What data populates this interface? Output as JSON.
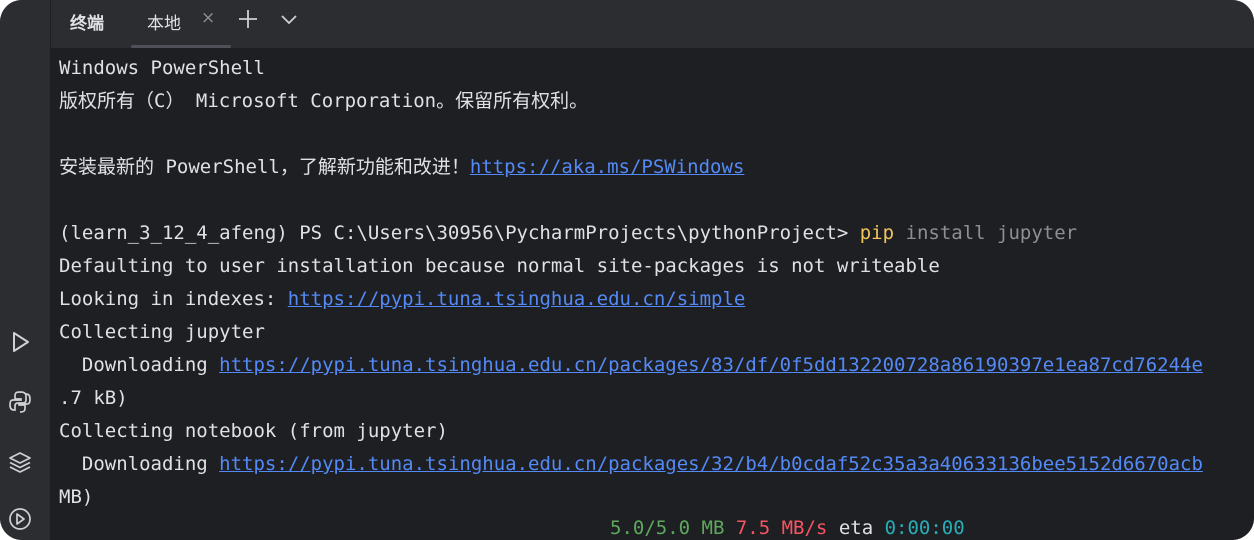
{
  "tabbar": {
    "title": "终端",
    "tab_label": "本地",
    "close_glyph": "×",
    "add_icon": "plus-icon",
    "menu_icon": "chevron-down-icon"
  },
  "sidebar": {
    "icons": [
      "run-icon",
      "python-console-icon",
      "layers-icon",
      "services-icon"
    ]
  },
  "terminal": {
    "lines": [
      "Windows PowerShell",
      "版权所有（C） Microsoft Corporation。保留所有权利。",
      "",
      "安装最新的 PowerShell，了解新功能和改进！",
      "",
      "(learn_3_12_4_afeng) PS C:\\Users\\30956\\PycharmProjects\\pythonProject> ",
      "Defaulting to user installation because normal site-packages is not writeable",
      "Looking in indexes: ",
      "Collecting jupyter",
      "  Downloading ",
      ".7 kB)",
      "Collecting notebook (from jupyter)",
      "  Downloading ",
      "MB)"
    ],
    "ps_link": "https://aka.ms/PSWindows",
    "cmd_pip": "pip",
    "cmd_args": " install jupyter",
    "index_link": "https://pypi.tuna.tsinghua.edu.cn/simple",
    "download_link_1": "https://pypi.tuna.tsinghua.edu.cn/packages/83/df/0f5dd132200728a86190397e1ea87cd76244e",
    "download_link_2": "https://pypi.tuna.tsinghua.edu.cn/packages/32/b4/b0cdaf52c35a3a40633136bee5152d6670acb",
    "progress": {
      "size": "5.0/5.0 MB",
      "speed": "7.5 MB/s",
      "eta_label": "eta",
      "eta_value": "0:00:00"
    }
  },
  "colors": {
    "background": "#1e1f22",
    "sidebar": "#2b2d30",
    "text": "#dfe1e5",
    "link": "#548af7",
    "pip": "#f2c55c",
    "args": "#8c8f94",
    "progress_green": "#5ea85e",
    "progress_red": "#f75464",
    "progress_teal": "#2aacb8"
  }
}
